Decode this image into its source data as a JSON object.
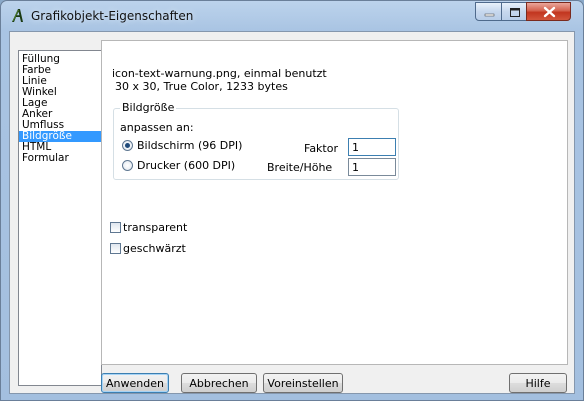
{
  "window": {
    "title": "Grafikobjekt-Eigenschaften",
    "background_title_smear": "",
    "icons": {
      "app": "grafik-a-icon",
      "minimize": "minimize-icon",
      "maximize": "maximize-icon",
      "close": "close-icon"
    }
  },
  "categories": {
    "items": [
      {
        "label": "Füllung"
      },
      {
        "label": "Farbe"
      },
      {
        "label": "Linie"
      },
      {
        "label": "Winkel"
      },
      {
        "label": "Lage"
      },
      {
        "label": "Anker"
      },
      {
        "label": "Umfluss"
      },
      {
        "label": "Bildgröße"
      },
      {
        "label": "HTML"
      },
      {
        "label": "Formular"
      }
    ],
    "selected": "Bildgröße"
  },
  "panel": {
    "file_name": "icon-text-warnung.png, einmal benutzt",
    "file_info": "30 x 30, True Color, 1233 bytes",
    "group": {
      "title": "Bildgröße",
      "adapt_label": "anpassen an:",
      "radio_screen": "Bildschirm (96 DPI)",
      "radio_printer": "Drucker (600 DPI)",
      "selected_radio": "screen",
      "faktor_label": "Faktor",
      "faktor_value": "1",
      "ratio_label": "Breite/Höhe",
      "ratio_value": "1"
    },
    "transparent_label": "transparent",
    "transparent_checked": false,
    "blackened_label": "geschwärzt",
    "blackened_checked": false
  },
  "buttons": {
    "apply": "Anwenden",
    "cancel": "Abbrechen",
    "preset": "Voreinstellen",
    "help": "Hilfe"
  },
  "colors": {
    "selection": "#3399ff",
    "close_button": "#c2351f",
    "frame": "#a9c4e3"
  }
}
